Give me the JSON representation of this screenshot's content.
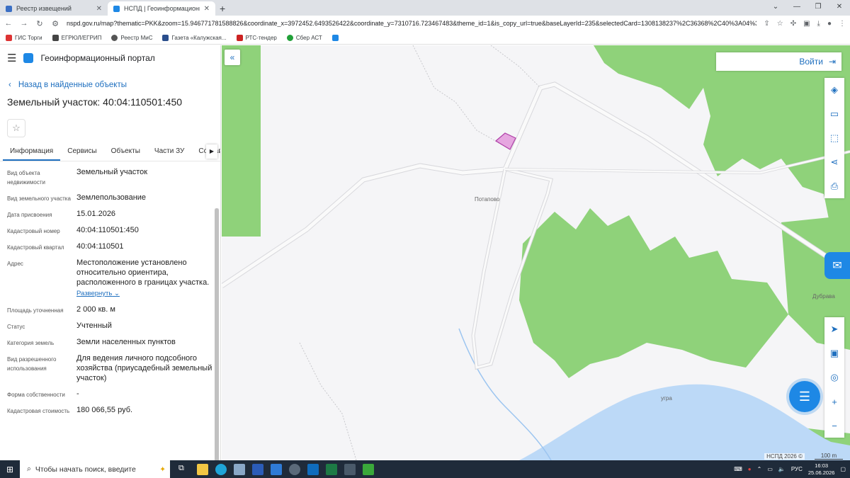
{
  "browser": {
    "tabs": [
      {
        "title": "Реестр извещений",
        "active": false
      },
      {
        "title": "НСПД | Геоинформационный п",
        "active": true
      }
    ],
    "url": "nspd.gov.ru/map?thematic=PKK&zoom=15.946771781588826&coordinate_x=3972452.6493526422&coordinate_y=7310716.723467483&theme_id=1&is_copy_url=true&baseLayerId=235&selectedCard=1308138237%2C36368%2C40%3A04%3A11...",
    "bookmarks": [
      "ГИС Торги",
      "ЕГРЮЛ/ЕГРИП",
      "Реестр МиС",
      "Газета «Калужская...",
      "РТС-тендер",
      "Сбер АСТ"
    ]
  },
  "panel": {
    "portal_title": "Геоинформационный портал",
    "back_link": "Назад в найденные объекты",
    "title": "Земельный участок: 40:04:110501:450",
    "tabs": [
      "Информация",
      "Сервисы",
      "Объекты",
      "Части ЗУ",
      "Состав"
    ],
    "properties": [
      {
        "key": "Вид объекта недвижимости",
        "value": "Земельный участок"
      },
      {
        "key": "Вид земельного участка",
        "value": "Землепользование"
      },
      {
        "key": "Дата присвоения",
        "value": "15.01.2026"
      },
      {
        "key": "Кадастровый номер",
        "value": "40:04:110501:450"
      },
      {
        "key": "Кадастровый квартал",
        "value": "40:04:110501"
      },
      {
        "key": "Адрес",
        "value": "Местоположение установлено относительно ориентира, расположенного в границах участка."
      },
      {
        "key": "Площадь уточненная",
        "value": "2 000 кв. м"
      },
      {
        "key": "Статус",
        "value": "Учтенный"
      },
      {
        "key": "Категория земель",
        "value": "Земли населенных пунктов"
      },
      {
        "key": "Вид разрешенного использования",
        "value": "Для ведения личного подсобного хозяйства (приусадебный земельный участок)"
      },
      {
        "key": "Форма собственности",
        "value": "-"
      },
      {
        "key": "Кадастровая стоимость",
        "value": "180 066,55 руб."
      }
    ],
    "expand_label": "Развернуть"
  },
  "map": {
    "login_label": "Войти",
    "labels": {
      "village1": "Потапово",
      "village2": "Дубрава",
      "river": "угра"
    },
    "attribution": "НСПД 2026 ©",
    "scale": "100 m"
  },
  "taskbar": {
    "search_placeholder": "Чтобы начать поиск, введите",
    "lang": "РУС",
    "time": "16:03",
    "date": "25.06.2026"
  },
  "colors": {
    "accent": "#1e6fbf",
    "forest": "#8fd27a",
    "water": "#bcd9f7",
    "parcel": "#d070c8"
  }
}
